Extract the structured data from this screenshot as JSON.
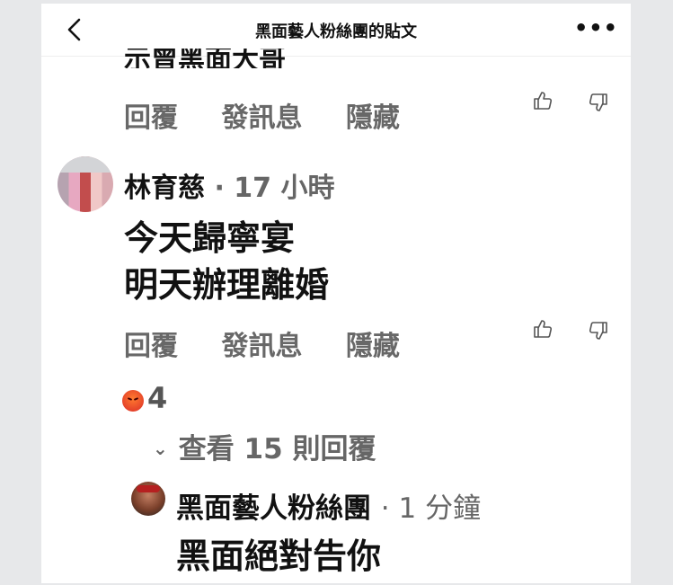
{
  "header": {
    "title": "黑面藝人粉絲團的貼文"
  },
  "partial_comment": {
    "text": "示曾黑面大哥"
  },
  "comment_actions": {
    "reply": "回覆",
    "message": "發訊息",
    "hide": "隱藏"
  },
  "comment1": {
    "author": "林育慈",
    "time": "· 17 小時",
    "lines": [
      "今天歸寧宴",
      "明天辦理離婚"
    ],
    "reaction_count": "4",
    "view_replies": "查看 15 則回覆"
  },
  "reply1": {
    "author": "黑面藝人粉絲團",
    "time": "· 1 分鐘",
    "text": "黑面絕對告你"
  }
}
